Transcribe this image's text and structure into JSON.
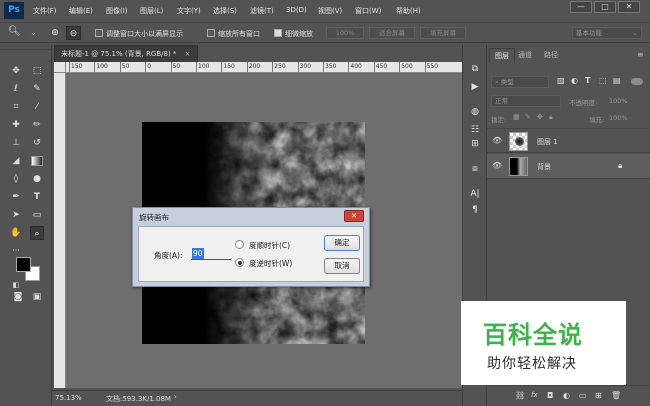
{
  "app": {
    "logo": "Ps",
    "menu": [
      "文件(F)",
      "编辑(E)",
      "图像(I)",
      "图层(L)",
      "文字(Y)",
      "选择(S)",
      "滤镜(T)",
      "3D(D)",
      "视图(V)",
      "窗口(W)",
      "帮助(H)"
    ],
    "window_controls": [
      "—",
      "□",
      "✕"
    ]
  },
  "options": {
    "zoom_menu": "⌄",
    "resize_windows_label": "调整窗口大小以满屏显示",
    "zoom_all_label": "缩放所有窗口",
    "scrubby_label": "细微缩放",
    "zoom_value": "100%",
    "fit_screen": "适合屏幕",
    "fill_screen": "填充屏幕",
    "workspace": "基本功能"
  },
  "document": {
    "tab_title": "未标题-1 @ 75.1% (背景, RGB/8) *",
    "tab_close": "×",
    "zoom": "75.13%",
    "doc_info": "文档:593.3K/1.08M",
    "ruler_ticks": [
      "150",
      "100",
      "50",
      "0",
      "50",
      "100",
      "150",
      "200",
      "250",
      "300",
      "350",
      "400",
      "450",
      "500",
      "550"
    ]
  },
  "dialog": {
    "title": "旋转画布",
    "close": "✕",
    "angle_label": "角度(A):",
    "angle_value": "90",
    "option_cw": "度顺时针(C)",
    "option_ccw": "度逆时针(W)",
    "ok": "确定",
    "cancel": "取消"
  },
  "layers_panel": {
    "tabs": [
      "图层",
      "通道",
      "路径"
    ],
    "filter_kind": "类型",
    "blend_mode": "正常",
    "opacity_label": "不透明度:",
    "opacity_value": "100%",
    "lock_label": "锁定:",
    "fill_label": "填充:",
    "fill_value": "100%",
    "layers": [
      {
        "name": "图层 1"
      },
      {
        "name": "背景",
        "locked": true
      }
    ],
    "bottom_icons": [
      "链接",
      "fx",
      "蒙版",
      "调整",
      "组",
      "新建",
      "删除"
    ]
  },
  "watermark": {
    "title": "百科全说",
    "subtitle": "助你轻松解决"
  },
  "colors": {
    "ui_bg": "#535353",
    "canvas_bg": "#6e6e6e",
    "dialog_frame": "#c6cfdc",
    "watermark_green": "#3bb44a"
  }
}
